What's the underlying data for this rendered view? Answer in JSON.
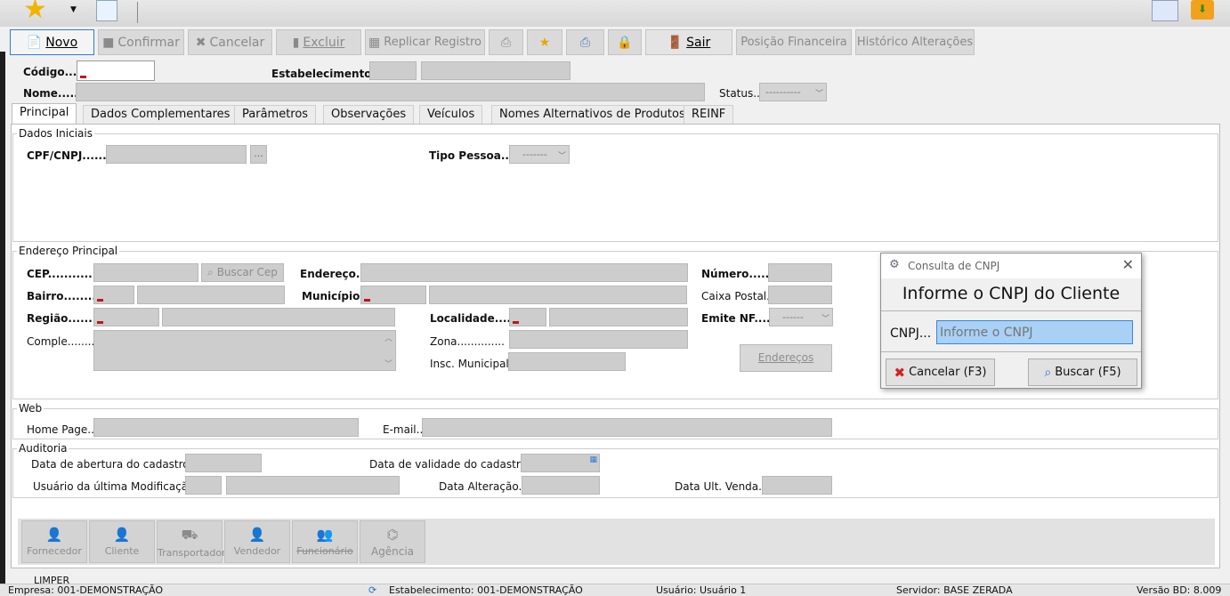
{
  "icons": [
    "star-icon",
    "dropdown-arrow-icon",
    "document-list-icon",
    "resize-icon",
    "download-icon",
    "new-document-icon",
    "confirm-icon",
    "cancel-icon",
    "delete-icon",
    "replicate-icon",
    "print-icon",
    "favorite-icon",
    "printer-config-icon",
    "lock-icon",
    "exit-icon"
  ],
  "toolbar": {
    "novo": "Novo",
    "confirmar": "Confirmar",
    "cancelar": "Cancelar",
    "excluir": "Excluir",
    "replicar": "Replicar Registro",
    "sair": "Sair",
    "posicao": "Posição Financeira",
    "historico": "Histórico Alterações"
  },
  "header": {
    "codigo": "Código....",
    "estabelecimento": "Estabelecimento..",
    "nome": "Nome......",
    "status": "Status..",
    "status_value": "----------"
  },
  "tabs": [
    "Principal",
    "Dados Complementares",
    "Parâmetros",
    "Observações",
    "Veículos",
    "Nomes Alternativos de Produtos",
    "REINF"
  ],
  "dados_iniciais": {
    "title": "Dados Iniciais",
    "cpf": "CPF/CNPJ.........",
    "ellipsis": "...",
    "tipo_pessoa": "Tipo Pessoa....",
    "tipo_pessoa_value": "-------"
  },
  "endereco": {
    "title": "Endereço Principal",
    "cep": "CEP.............",
    "buscar_cep": "Buscar Cep",
    "endereco": "Endereço...",
    "numero": "Número.......",
    "bairro": "Bairro..........",
    "municipio": "Município..",
    "caixa_postal": "Caixa Postal..",
    "regiao": "Região.........",
    "localidade": "Localidade......",
    "emite_nf": "Emite NF.......",
    "emite_nf_value": "------",
    "comple": "Comple.........",
    "zona": "Zona..............",
    "insc_municipal": "Insc. Municipal..",
    "enderecos_btn": "Endereços"
  },
  "web": {
    "title": "Web",
    "home_page": "Home Page..",
    "email": "E-mail.."
  },
  "auditoria": {
    "title": "Auditoria",
    "data_abertura": "Data de abertura do cadastro",
    "data_validade": "Data de validade do cadastro",
    "usuario_mod": "Usuário da última Modificação...",
    "data_alteracao": "Data Alteração..",
    "data_ult_venda": "Data Ult. Venda.."
  },
  "bottom_buttons": [
    "Fornecedor",
    "Cliente",
    "Transportador",
    "Vendedor",
    "Funcionário",
    "Agência"
  ],
  "bottom_partial": "LIMPER",
  "status_bar": {
    "empresa": "Empresa: 001-DEMONSTRAÇÃO",
    "estabelecimento": "Estabelecimento: 001-DEMONSTRAÇÃO",
    "usuario": "Usuário: Usuário 1",
    "servidor": "Servidor: BASE ZERADA",
    "versao": "Versão BD: 8.009"
  },
  "dialog": {
    "title": "Consulta de CNPJ",
    "heading": "Informe o CNPJ do Cliente",
    "cnpj_label": "CNPJ...",
    "cnpj_placeholder": "Informe o CNPJ",
    "cancel": "Cancelar (F3)",
    "search": "Buscar (F5)"
  },
  "colors": {
    "accent": "#2d7bd6",
    "disabled_field": "#cdcdcd",
    "required_marker": "#c0141e",
    "cancel_red": "#d42020"
  }
}
